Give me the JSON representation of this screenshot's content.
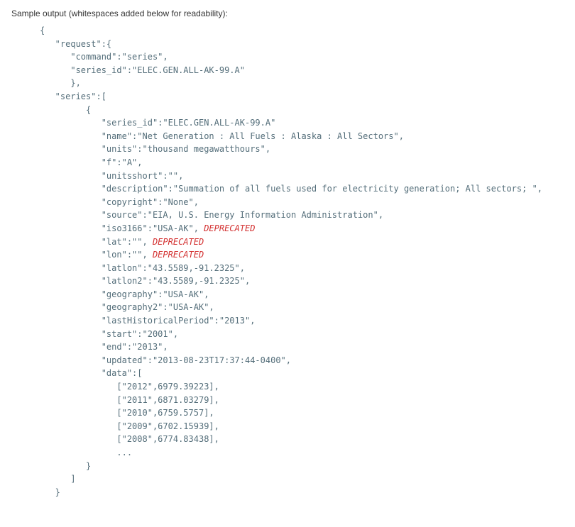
{
  "heading": "Sample output (whitespaces added below for readability):",
  "deprecated_label": "DEPRECATED",
  "lines": {
    "l0": "{",
    "l1": "   \"request\":{",
    "l2": "      \"command\":\"series\",",
    "l3": "      \"series_id\":\"ELEC.GEN.ALL-AK-99.A\"",
    "l4": "      },",
    "l5": "   \"series\":[",
    "l6": "         {",
    "l7": "            \"series_id\":\"ELEC.GEN.ALL-AK-99.A\"",
    "l8": "            \"name\":\"Net Generation : All Fuels : Alaska : All Sectors\",",
    "l9": "            \"units\":\"thousand megawatthours\",",
    "l10": "            \"f\":\"A\",",
    "l11": "            \"unitsshort\":\"\",",
    "l12": "            \"description\":\"Summation of all fuels used for electricity generation; All sectors; \",",
    "l13": "            \"copyright\":\"None\",",
    "l14": "            \"source\":\"EIA, U.S. Energy Information Administration\",",
    "l15a": "            \"iso3166\":\"USA-AK\", ",
    "l16a": "            \"lat\":\"\", ",
    "l17a": "            \"lon\":\"\", ",
    "l18": "            \"latlon\":\"43.5589,-91.2325\",",
    "l19": "            \"latlon2\":\"43.5589,-91.2325\",",
    "l20": "            \"geography\":\"USA-AK\",",
    "l21": "            \"geography2\":\"USA-AK\",",
    "l22": "            \"lastHistoricalPeriod\":\"2013\",",
    "l23": "            \"start\":\"2001\",",
    "l24": "            \"end\":\"2013\",",
    "l25": "            \"updated\":\"2013-08-23T17:37:44-0400\",",
    "l26": "            \"data\":[",
    "l27": "               [\"2012\",6979.39223],",
    "l28": "               [\"2011\",6871.03279],",
    "l29": "               [\"2010\",6759.5757],",
    "l30": "               [\"2009\",6702.15939],",
    "l31": "               [\"2008\",6774.83438],",
    "l32": "               ...",
    "l33": "         }",
    "l34": "      ]",
    "l35": "   }"
  }
}
